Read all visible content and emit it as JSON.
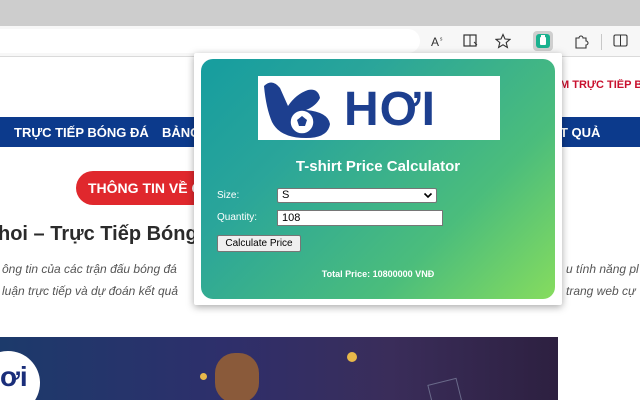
{
  "browser": {
    "toolbar_icons": [
      "read-aloud-icon",
      "immersive-reader-icon",
      "favorite-star-icon",
      "extension-icon",
      "extensions-puzzle-icon",
      "split-screen-icon"
    ]
  },
  "website": {
    "brand_right": "M TRỰC TIẾP B",
    "nav": {
      "item1": "TRỰC TIẾP BÓNG ĐÁ",
      "item2": "BẢNG",
      "item_right": "T QUẢ"
    },
    "pill": "THÔNG TIN VỀ C",
    "headline": "hoi – Trực Tiếp Bóng",
    "para_left_1": "ông tin của các trận đấu bóng đá",
    "para_left_2": "luận trực tiếp và dự đoán kết quả",
    "para_right_1": "u tính năng pl",
    "para_right_2": "trang web cự",
    "hero_text": "ơi",
    "colors": {
      "nav": "#0c3a8c",
      "pill": "#e0282d"
    }
  },
  "popup": {
    "logo_text": "HƠI",
    "title": "T-shirt Price Calculator",
    "size_label": "Size:",
    "size_value": "S",
    "quantity_label": "Quantity:",
    "quantity_value": "108",
    "button_label": "Calculate Price",
    "total": "Total Price: 10800000 VNĐ",
    "colors": {
      "gradient_start": "#169d9f",
      "gradient_end": "#86dc5e"
    }
  }
}
